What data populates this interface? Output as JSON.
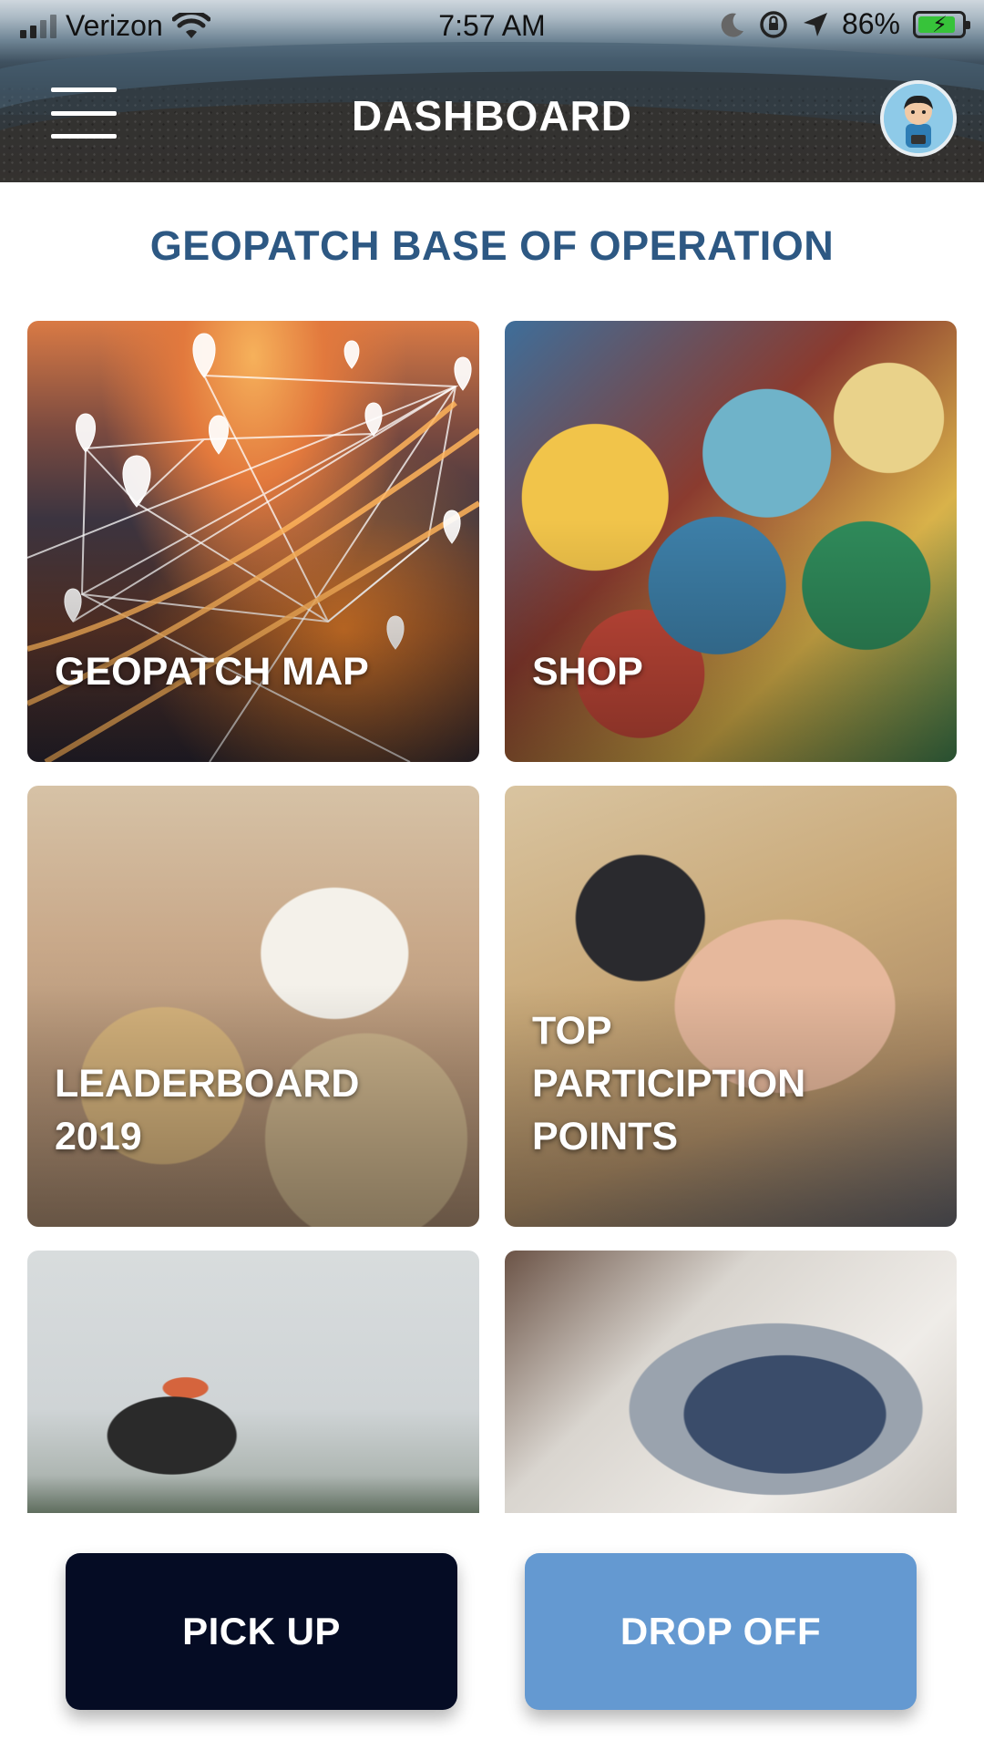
{
  "status_bar": {
    "carrier": "Verizon",
    "time": "7:57 AM",
    "battery_percent": "86%",
    "battery_level": 0.86,
    "icons": [
      "cellular-signal-icon",
      "wifi-icon",
      "moon-icon",
      "rotation-lock-icon",
      "location-arrow-icon",
      "battery-charging-icon"
    ]
  },
  "header": {
    "title": "DASHBOARD",
    "menu_icon": "hamburger-menu-icon",
    "avatar_icon": "user-avatar-icon"
  },
  "section": {
    "heading": "GEOPATCH BASE OF OPERATION"
  },
  "tiles": [
    {
      "label": "GEOPATCH MAP"
    },
    {
      "label": "SHOP"
    },
    {
      "label": "LEADERBOARD\n2019"
    },
    {
      "label": "TOP\nPARTICIPTION\nPOINTS"
    },
    {
      "label": ""
    },
    {
      "label": ""
    }
  ],
  "actions": {
    "pickup_label": "PICK UP",
    "dropoff_label": "DROP OFF"
  },
  "colors": {
    "heading": "#2d5883",
    "pickup_button": "#050c24",
    "dropoff_button": "#6499d1"
  }
}
